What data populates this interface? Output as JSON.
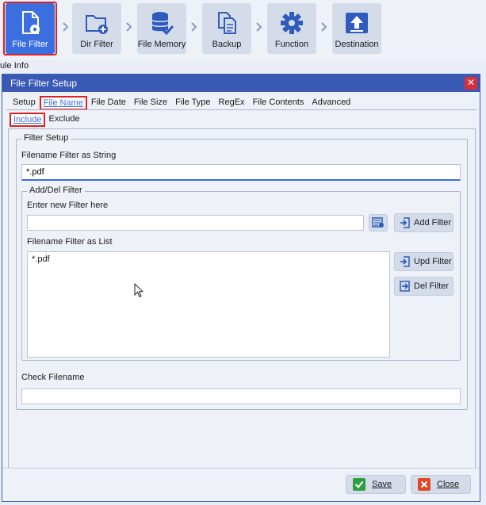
{
  "toolbar": {
    "items": [
      {
        "label": "File Filter",
        "icon": "file-gear-icon"
      },
      {
        "label": "Dir Filter",
        "icon": "folder-add-icon"
      },
      {
        "label": "File Memory",
        "icon": "database-check-icon"
      },
      {
        "label": "Backup",
        "icon": "copy-files-icon"
      },
      {
        "label": "Function",
        "icon": "gear-icon"
      },
      {
        "label": "Destination",
        "icon": "upload-icon"
      }
    ],
    "active_index": 0
  },
  "behind_label": "ule Info",
  "dialog": {
    "title": "File Filter Setup",
    "close_glyph": "✕",
    "tabs": [
      "Setup",
      "File Name",
      "File Date",
      "File Size",
      "File Type",
      "RegEx",
      "File Contents",
      "Advanced"
    ],
    "active_tab": "File Name",
    "subtabs": [
      "Include",
      "Exclude"
    ],
    "active_subtab": "Include",
    "filter_setup": {
      "group_title": "Filter Setup",
      "string_label": "Filename Filter as String",
      "string_value": "*.pdf",
      "add_del": {
        "group_title": "Add/Del Filter",
        "new_filter_label": "Enter new Filter here",
        "new_filter_value": "",
        "add_button": "Add Filter",
        "list_label": "Filename Filter as List",
        "list_items": [
          "*.pdf"
        ],
        "upd_button": "Upd Filter",
        "del_button": "Del Filter"
      },
      "check_label": "Check Filename",
      "check_value": ""
    },
    "footer": {
      "save": "Save",
      "close": "Close"
    }
  },
  "colors": {
    "accent": "#3b6fe0",
    "title_bar": "#3959b5",
    "highlight": "#e02020"
  }
}
